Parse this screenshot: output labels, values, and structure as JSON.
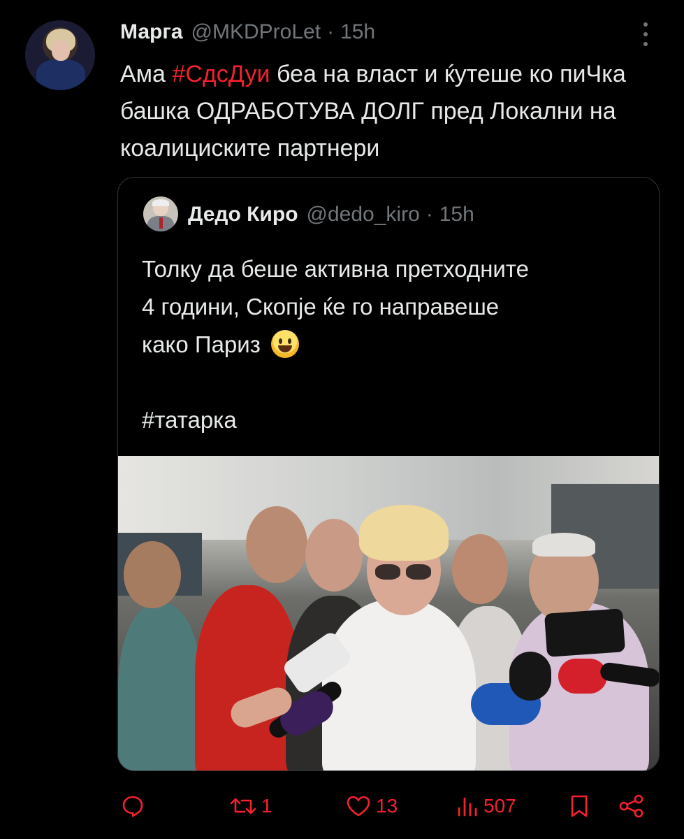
{
  "tweet": {
    "display_name": "Марга",
    "handle": "@MKDProLet",
    "separator": "·",
    "time": "15h",
    "text_before": "Ама ",
    "hashtag": "#СдсДуи",
    "text_after": " беа на власт и ќутеше ко пиЧка башка ОДРАБОТУВА ДОЛГ пред Локални на коалициските партнери",
    "avatar_icon": "profile-photo",
    "more_icon": "more-vertical-icon"
  },
  "quote": {
    "display_name": "Дедо Киро",
    "handle": "@dedo_kiro",
    "separator": "·",
    "time": "15h",
    "line1": "Толку да беше активна претходните",
    "line2": "4 години, Скопје ќе го направеше",
    "line3": "како Париз",
    "emoji": "grinning-face-emoji",
    "hashtag": "#татарка",
    "media": "press-conference-photo"
  },
  "actions": {
    "reply_count": "",
    "retweet_count": "1",
    "like_count": "13",
    "views_count": "507"
  },
  "colors": {
    "background": "#000000",
    "text": "#e7e9ea",
    "secondary": "#71767b",
    "accent": "#f4212e",
    "border": "#2f3336"
  }
}
